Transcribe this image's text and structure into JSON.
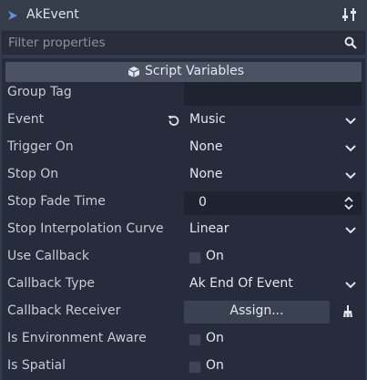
{
  "header": {
    "title": "AkEvent"
  },
  "filter": {
    "placeholder": "Filter properties"
  },
  "section": {
    "label": "Script Variables"
  },
  "properties": [
    {
      "name": "Group Tag",
      "kind": "text",
      "value": ""
    },
    {
      "name": "Event",
      "kind": "dropdown",
      "value": "Music",
      "revertable": true
    },
    {
      "name": "Trigger On",
      "kind": "dropdown",
      "value": "None"
    },
    {
      "name": "Stop On",
      "kind": "dropdown",
      "value": "None"
    },
    {
      "name": "Stop Fade Time",
      "kind": "spin",
      "value": "0"
    },
    {
      "name": "Stop Interpolation Curve",
      "kind": "dropdown",
      "value": "Linear"
    },
    {
      "name": "Use Callback",
      "kind": "checkbox",
      "value": "On",
      "checked": false
    },
    {
      "name": "Callback Type",
      "kind": "dropdown",
      "value": "Ak End Of Event"
    },
    {
      "name": "Callback Receiver",
      "kind": "assign",
      "value": "Assign..."
    },
    {
      "name": "Is Environment Aware",
      "kind": "checkbox",
      "value": "On",
      "checked": false
    },
    {
      "name": "Is Spatial",
      "kind": "checkbox",
      "value": "On",
      "checked": false
    }
  ],
  "icons": {
    "node": "node-icon",
    "tools": "tools-icon",
    "search": "search-icon",
    "section": "cube-icon",
    "revert": "revert-icon",
    "dropdown": "chevron-down-icon",
    "spin": "up-down-arrows-icon",
    "clear": "broom-icon"
  },
  "colors": {
    "background": "#333b4f",
    "panel": "#262c3b",
    "accent": "#5e95e0",
    "text": "#e4e7ee"
  }
}
